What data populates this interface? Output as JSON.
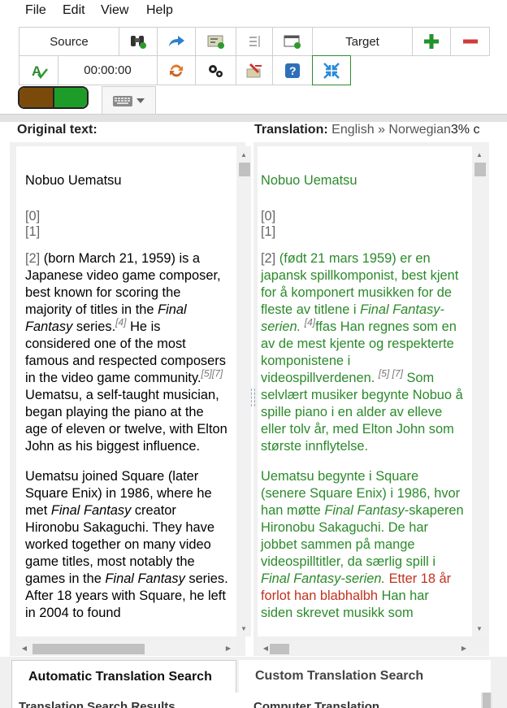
{
  "menu": {
    "items": [
      {
        "label": "File"
      },
      {
        "label": "Edit"
      },
      {
        "label": "View"
      },
      {
        "label": "Help"
      }
    ]
  },
  "toolbar": {
    "source_label": "Source",
    "target_label": "Target",
    "timer": "00:00:00",
    "progress_colors": [
      "#7a4a0a",
      "#1e9c2a"
    ]
  },
  "panes": {
    "original_header": "Original text:",
    "translation_header": "Translation:",
    "translation_langs": "English » Norwegian",
    "translation_percent": "3% c",
    "original": {
      "title": "Nobuo Uematsu",
      "marks": [
        "[0]",
        "[1]"
      ],
      "p1": {
        "ref": "[2]",
        "a": "(born March 21, 1959) is a Japanese video game composer, best known for scoring the majority of titles in the",
        "em1": "Final Fantasy",
        "b": "series.",
        "sup1": "[4]",
        "c": "He is considered one of the most famous and respected composers in the video game community.",
        "sup2": "[5][7]",
        "d": "Uematsu, a self-taught musician, began playing the piano at the age of eleven or twelve, with Elton John as his biggest influence."
      },
      "p2": {
        "a": "Uematsu joined Square (later Square Enix) in 1986, where he met",
        "em1": "Final Fantasy",
        "b": "creator Hironobu Sakaguchi. They have worked together on many video game titles, most notably the games in the",
        "em2": "Final Fantasy",
        "c": "series. After 18 years with Square, he left in 2004 to found"
      }
    },
    "translation": {
      "title": "Nobuo Uematsu",
      "marks": [
        "[0]",
        "[1]"
      ],
      "p1": {
        "ref": "[2]",
        "a": "(født 21 mars 1959) er en japansk spillkomponist, best kjent for å komponert musikken for de fleste av titlene i",
        "em1": "Final Fantasy-serien.",
        "sup1": "[4]",
        "b": "ffas Han regnes som en av de mest kjente og respekterte komponistene i videospillverdenen.",
        "sup2": "[5] [7]",
        "c": "Som selvlært musiker begynte Nobuo å spille piano i en alder av elleve eller tolv år, med Elton John som største innflytelse."
      },
      "p2": {
        "a": "Uematsu begynte i Square (senere Square Enix) i 1986, hvor han møtte",
        "em1": "Final Fantasy",
        "b": "-skaperen Hironobu Sakaguchi. De har jobbet sammen på mange videospilltitler, da særlig spill i",
        "em2": "Final Fantasy-serien.",
        "untranslated": "Etter 18 år forlot han blabhalbh",
        "c": "Han har siden skrevet musikk som"
      }
    }
  },
  "tabs": {
    "auto": "Automatic Translation Search",
    "custom": "Custom Translation Search"
  },
  "bottom": {
    "left_header": "Translation Search Results",
    "right_header": "Computer Translation"
  }
}
